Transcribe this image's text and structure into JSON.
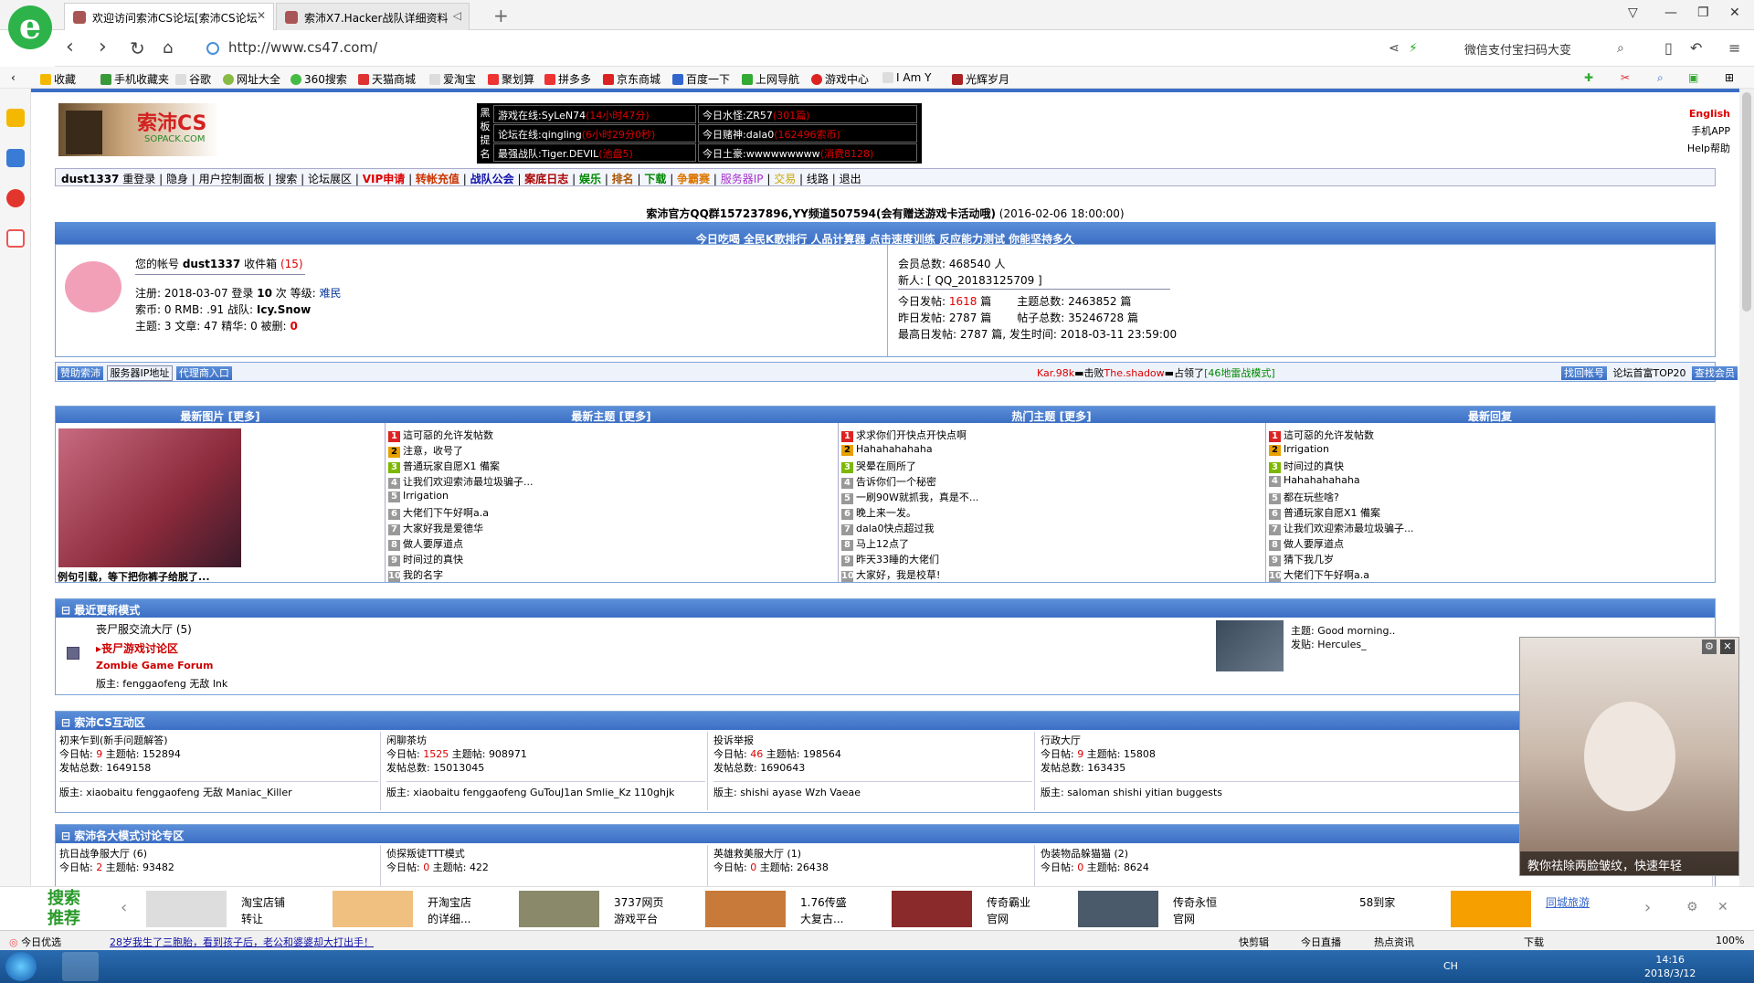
{
  "browser": {
    "tabs": [
      {
        "title": "欢迎访问索沛CS论坛[索沛CS论坛"
      },
      {
        "title": "索沛X7.Hacker战队详细资料"
      }
    ],
    "url": "http://www.cs47.com/",
    "search_placeholder": "微信支付宝扫码大变"
  },
  "bookmarks": [
    "收藏",
    "手机收藏夹",
    "谷歌",
    "网址大全",
    "360搜索",
    "天猫商城",
    "爱淘宝",
    "聚划算",
    "拼多多",
    "京东商城",
    "百度一下",
    "上网导航",
    "游戏中心",
    "I Am Y",
    "光辉岁月"
  ],
  "header": {
    "logo": "索沛CS",
    "logo_sub": "SOPACK.COM",
    "side": [
      "黑",
      "板",
      "提",
      "名"
    ],
    "board": [
      [
        "游戏在线:SyLeN74",
        "(14小时47分)"
      ],
      [
        "今日水怪:ZR57",
        "(301篇)"
      ],
      [
        "论坛在线:qingling",
        "(6小时29分0秒)"
      ],
      [
        "今日赌神:dala0",
        "(162496索币)"
      ],
      [
        "最强战队:Tiger.DEVIL",
        "(池盘5)"
      ],
      [
        "今日土豪:wwwwwwwww",
        "(消费8128)"
      ]
    ],
    "right_links": [
      "English",
      "手机APP",
      "Help帮助"
    ]
  },
  "menu": [
    "dust1337",
    "重登录",
    "隐身",
    "用户控制面板",
    "搜索",
    "论坛展区",
    "VIP申请",
    "转帐充值",
    "战队公会",
    "案底日志",
    "娱乐",
    "排名",
    "下载",
    "争霸赛",
    "服务器IP",
    "交易",
    "线路",
    "退出"
  ],
  "notice": {
    "text": "索沛官方QQ群157237896,YY频道507594(会有赠送游戏卡活动哦)",
    "time": "(2016-02-06 18:00:00)"
  },
  "quicklinks": [
    "今日吃喝",
    "全民K歌排行",
    "人品计算器",
    "点击速度训练",
    "反应能力测试",
    "你能坚持多久"
  ],
  "user": {
    "account_label": "您的帐号",
    "name": "dust1337",
    "inbox": "收件箱",
    "inbox_count": "(15)",
    "reg": "注册: 2018-03-07 登录",
    "logins": "10",
    "times": "次 等级:",
    "level": "难民",
    "coins": "索币: 0 RMB: .91 战队:",
    "team": "Icy.Snow",
    "stats": "主题: 3 文章: 47 精华: 0 被删:",
    "deleted": "0"
  },
  "site": {
    "members": "会员总数: 468540 人",
    "newuser": "新人: [ QQ_20183125709 ]",
    "today": "今日发帖:",
    "today_n": "1618",
    "today_u": "篇",
    "topics": "主题总数: 2463852 篇",
    "yesterday": "昨日发帖: 2787 篇",
    "posts": "帖子总数: 35246728 篇",
    "max": "最高日发帖: 2787 篇, 发生时间: 2018-03-11 23:59:00"
  },
  "actionbar": {
    "left": [
      "赞助索沛",
      "服务器IP地址",
      "代理商入口"
    ],
    "kill_a": "Kar.98k",
    "kill_b": "击败",
    "kill_c": "The.shadow",
    "kill_d": "占领了",
    "kill_e": "[46地雷战模式]",
    "right": [
      "找回帐号",
      "论坛首富TOP20",
      "查找会员"
    ]
  },
  "cols": {
    "titles": [
      "最新图片 [更多]",
      "最新主题 [更多]",
      "热门主题 [更多]",
      "最新回复"
    ],
    "pic_caption": "例句引载，等下把你裤子给脱了...",
    "latest": [
      "這可惡的允许发帖数",
      "注意，收号了",
      "普通玩家自愿X1 備案",
      "让我们欢迎索沛最垃圾骗子...",
      "Irrigation",
      "大佬们下午好啊a.a",
      "大家好我是爱德华",
      "做人要厚道点",
      "时间过的真快",
      "我的名字"
    ],
    "hot": [
      "求求你们开快点开快点啊",
      "Hahahahahaha",
      "哭晕在厕所了",
      "告诉你们一个秘密",
      "一刷90W就抓我，真是不...",
      "晚上来一发。",
      "dala0快点超过我",
      "马上12点了",
      "昨天33睡的大佬们",
      "大家好，我是校草!"
    ],
    "reply": [
      "這可惡的允许发帖数",
      "Irrigation",
      "时间过的真快",
      "Hahahahahaha",
      "都在玩些啥?",
      "普通玩家自愿X1 備案",
      "让我们欢迎索沛最垃圾骗子...",
      "做人要厚道点",
      "猜下我几岁",
      "大佬们下午好啊a.a"
    ]
  },
  "recent": {
    "title": "最近更新模式",
    "hall": "丧尸服交流大厅 (5)",
    "forum": "丧尸游戏讨论区",
    "forum_en": "Zombie Game Forum",
    "mod": "版主: fenggaofeng 无敌 lnk",
    "topic": "主题: Good morning..",
    "poster": "发贴: Hercules_"
  },
  "interact": {
    "title": "索沛CS互动区",
    "boards": [
      {
        "name": "初来乍到(新手问题解答)",
        "today": "9",
        "topics": "152894",
        "total": "1649158",
        "mods": "版主: xiaobaitu fenggaofeng 无敌 Maniac_Killer"
      },
      {
        "name": "闲聊茶坊",
        "today": "1525",
        "topics": "908971",
        "total": "15013045",
        "mods": "版主: xiaobaitu fenggaofeng GuTouJ1an Smlie_Kz 110ghjk"
      },
      {
        "name": "投诉举报",
        "today": "46",
        "topics": "198564",
        "total": "1690643",
        "mods": "版主: shishi ayase Wzh Vaeae"
      },
      {
        "name": "行政大厅",
        "today": "9",
        "topics": "15808",
        "total": "163435",
        "mods": "版主: saloman shishi yitian buggests"
      }
    ]
  },
  "modes": {
    "title": "索沛各大模式讨论专区",
    "boards": [
      {
        "name": "抗日战争服大厅 (6)",
        "today": "2",
        "topics": "93482"
      },
      {
        "name": "侦探叛徒TTT模式",
        "today": "0",
        "topics": "422"
      },
      {
        "name": "英雄救美服大厅 (1)",
        "today": "0",
        "topics": "26438"
      },
      {
        "name": "伪装物品躲猫猫 (2)",
        "today": "0",
        "topics": "8624"
      }
    ]
  },
  "labels": {
    "today": "今日帖:",
    "topics": "主题帖:",
    "total": "发帖总数:"
  },
  "ad": {
    "caption": "教你祛除两脸皱纹，快速年轻"
  },
  "bottom": {
    "title": "搜索推荐",
    "items": [
      [
        "淘宝店铺",
        "转让"
      ],
      [
        "开淘宝店",
        "的详细..."
      ],
      [
        "3737网页",
        "游戏平台"
      ],
      [
        "1.76传盛",
        "大复古..."
      ],
      [
        "传奇霸业",
        "官网"
      ],
      [
        "传奇永恒",
        "官网"
      ],
      [
        "58到家",
        ""
      ],
      [
        "同城旅游",
        ""
      ]
    ]
  },
  "status": {
    "left": "今日优选",
    "news": "28岁我生了三胞胎，看到孩子后，老公和婆婆却大打出手！",
    "right": [
      "快剪辑",
      "今日直播",
      "热点资讯",
      "下载"
    ],
    "zoom": "100%"
  },
  "taskbar": {
    "time": "14:16",
    "date": "2018/3/12",
    "lang": "CH"
  }
}
